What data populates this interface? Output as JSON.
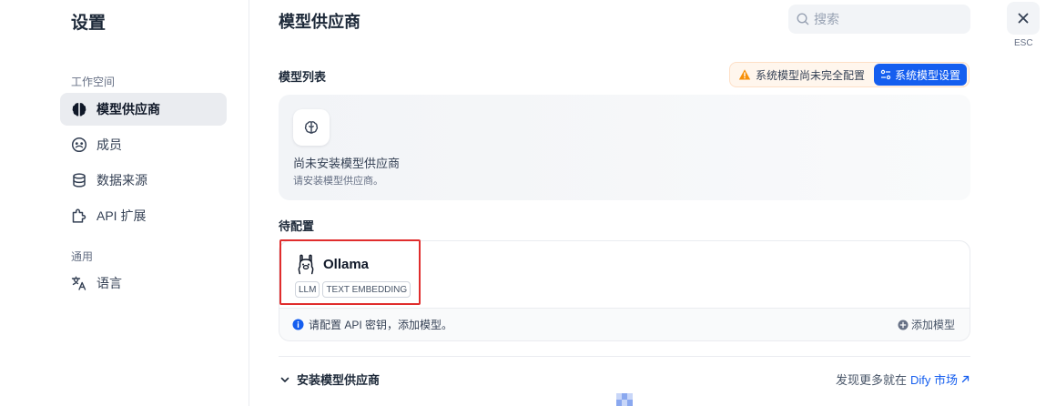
{
  "sidebar": {
    "title": "设置",
    "groups": [
      {
        "label": "工作空间",
        "items": [
          {
            "label": "模型供应商",
            "icon": "brain-icon",
            "active": true
          },
          {
            "label": "成员",
            "icon": "members-icon",
            "active": false
          },
          {
            "label": "数据来源",
            "icon": "database-icon",
            "active": false
          },
          {
            "label": "API 扩展",
            "icon": "puzzle-icon",
            "active": false
          }
        ]
      },
      {
        "label": "通用",
        "items": [
          {
            "label": "语言",
            "icon": "translate-icon",
            "active": false
          }
        ]
      }
    ]
  },
  "header": {
    "title": "模型供应商",
    "search_placeholder": "搜索",
    "esc_label": "ESC"
  },
  "model_list": {
    "title": "模型列表",
    "warning": "系统模型尚未完全配置",
    "system_button": "系统模型设置",
    "empty_title": "尚未安装模型供应商",
    "empty_sub": "请安装模型供应商。"
  },
  "pending": {
    "title": "待配置",
    "provider": {
      "name": "Ollama",
      "tags": [
        "LLM",
        "TEXT EMBEDDING"
      ],
      "hint": "请配置 API 密钥，添加模型。",
      "add_model": "添加模型"
    }
  },
  "install": {
    "label": "安装模型供应商",
    "discover_text": "发现更多就在",
    "discover_link": "Dify 市场"
  },
  "colors": {
    "accent": "#155eef",
    "warning": "#f79009",
    "highlight_border": "#e02d2d"
  }
}
